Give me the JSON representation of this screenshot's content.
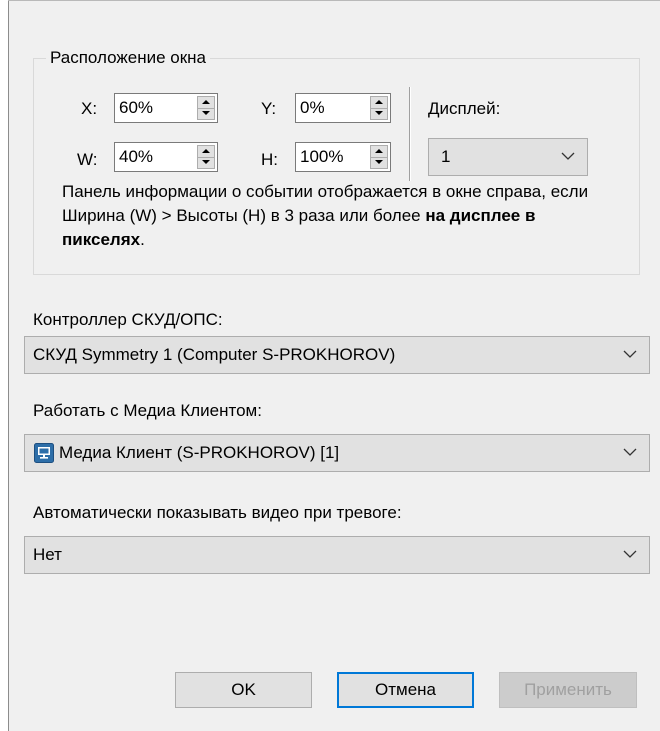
{
  "window_position": {
    "group_title": "Расположение окна",
    "x_label": "X:",
    "x_value": "60%",
    "y_label": "Y:",
    "y_value": "0%",
    "w_label": "W:",
    "w_value": "40%",
    "h_label": "H:",
    "h_value": "100%",
    "display_label": "Дисплей:",
    "display_value": "1",
    "info_text_normal": "Панель информации о событии отображается в окне справа, если Ширина (W) > Высоты (H) в 3 раза или более ",
    "info_text_bold": "на дисплее в пикселях",
    "info_text_end": "."
  },
  "controller": {
    "label": "Контроллер СКУД/ОПС:",
    "value": "СКУД Symmetry 1 (Computer S-PROKHOROV)"
  },
  "media_client": {
    "label": "Работать с Медиа Клиентом:",
    "value": "Медиа Клиент (S-PROKHOROV) [1]",
    "icon": "monitor-icon"
  },
  "auto_video": {
    "label": "Автоматически показывать видео при тревоге:",
    "value": "Нет"
  },
  "buttons": {
    "ok": "OK",
    "cancel": "Отмена",
    "apply": "Применить"
  },
  "colors": {
    "background": "#f0f0f0",
    "combo_bg": "#e1e1e1",
    "default_button_border": "#0078d7",
    "icon_blue": "#2d6ea8"
  }
}
